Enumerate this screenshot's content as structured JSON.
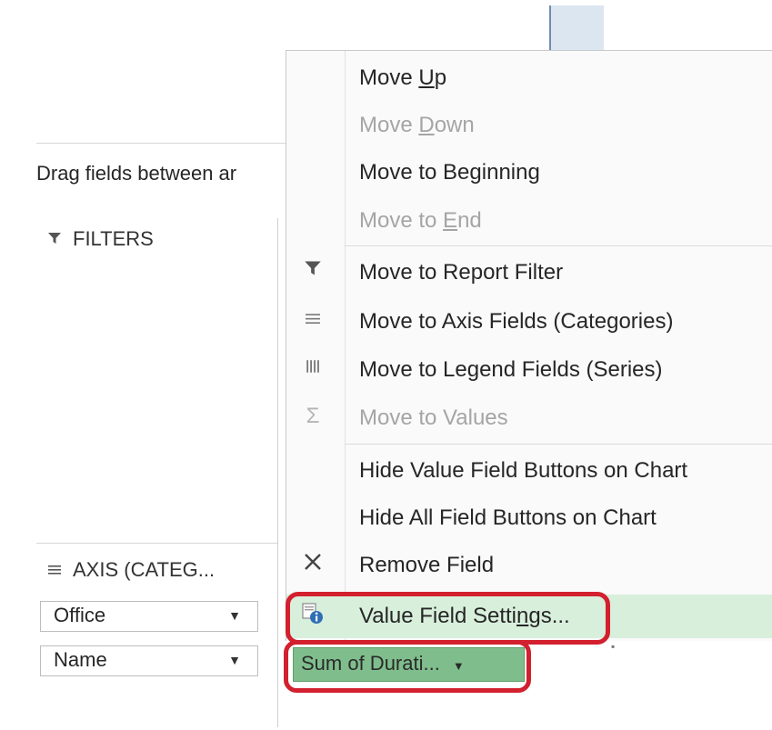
{
  "field_list": {
    "instruction": "Drag fields between ar",
    "filters_title": "FILTERS",
    "axis_title": "AXIS (CATEG...",
    "axis_fields": [
      "Office",
      "Name"
    ],
    "values_field": "Sum of Durati..."
  },
  "context_menu": {
    "move_up": {
      "before": "Move ",
      "key": "U",
      "after": "p"
    },
    "move_down": {
      "before": "Move ",
      "key": "D",
      "after": "own"
    },
    "move_to_beginning": {
      "before": "Move to Be",
      "key": "g",
      "after": "inning"
    },
    "move_to_end": {
      "before": "Move to ",
      "key": "E",
      "after": "nd"
    },
    "move_to_report_filter": "Move to Report Filter",
    "move_to_axis_fields": "Move to Axis Fields (Categories)",
    "move_to_legend_fields": "Move to Legend Fields (Series)",
    "move_to_values": "Move to Values",
    "hide_value_field_buttons": "Hide Value Field Buttons on Chart",
    "hide_all_field_buttons": "Hide All Field Buttons on Chart",
    "remove_field": "Remove Field",
    "value_field_settings": {
      "before": "Value Field Setti",
      "key": "n",
      "after": "gs..."
    }
  },
  "icons": {
    "filter": "filter-icon",
    "axis": "list-lines-icon",
    "legend": "columns-icon",
    "values": "sigma-icon",
    "remove": "close-x-icon",
    "settings": "field-settings-info-icon"
  },
  "colors": {
    "highlight_outline": "#d2202e",
    "values_field_bg": "#7fbe8c",
    "menu_highlight": "#d8efdc"
  }
}
